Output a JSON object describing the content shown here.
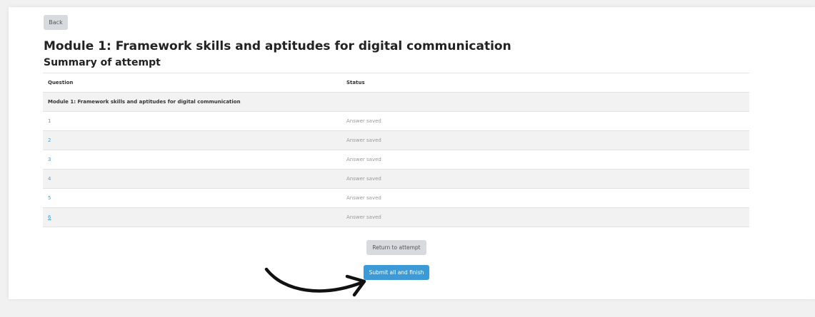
{
  "header": {
    "back_label": "Back"
  },
  "page": {
    "title": "Module 1: Framework skills and aptitudes for digital communication",
    "subtitle": "Summary of attempt"
  },
  "table": {
    "headers": {
      "question": "Question",
      "status": "Status"
    },
    "section_label": "Module 1: Framework skills and aptitudes for digital communication",
    "rows": [
      {
        "question": "1",
        "status": "Answer saved"
      },
      {
        "question": "2",
        "status": "Answer saved"
      },
      {
        "question": "3",
        "status": "Answer saved"
      },
      {
        "question": "4",
        "status": "Answer saved"
      },
      {
        "question": "5",
        "status": "Answer saved"
      },
      {
        "question": "6",
        "status": "Answer saved"
      }
    ]
  },
  "actions": {
    "return_label": "Return to attempt",
    "submit_label": "Submit all and finish"
  },
  "annotation": {
    "icon": "curved-arrow-icon"
  },
  "colors": {
    "link": "#4a9fd8",
    "submit_button": "#3d9ad6",
    "secondary_button": "#d7dade",
    "stripe": "#f2f2f2"
  }
}
